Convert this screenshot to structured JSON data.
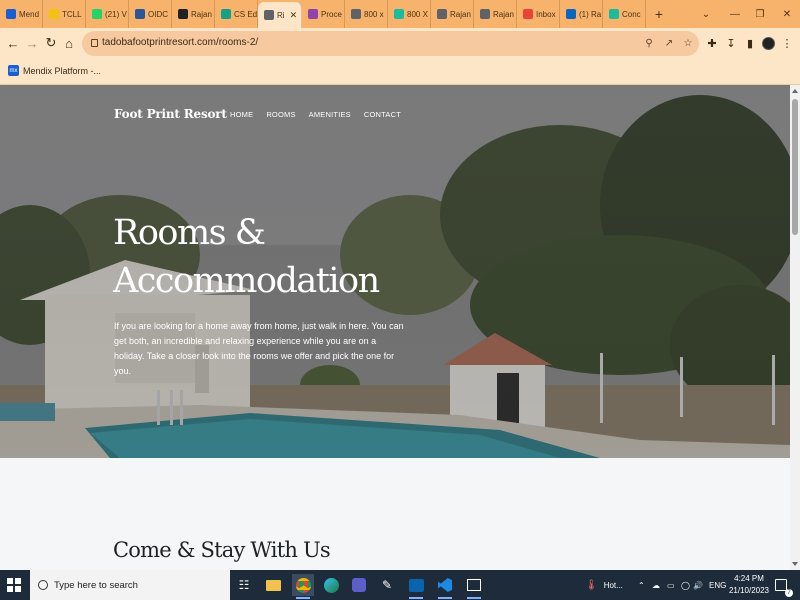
{
  "browser": {
    "tabs": [
      {
        "label": "Mend",
        "color": "#1a5fd0"
      },
      {
        "label": "TCLL",
        "color": "#f1c40f"
      },
      {
        "label": "(21) V",
        "color": "#25d366"
      },
      {
        "label": "OIDC",
        "color": "#2b5797"
      },
      {
        "label": "Rajan",
        "color": "#222222"
      },
      {
        "label": "CS Ed",
        "color": "#16a085"
      },
      {
        "label": "Ri",
        "color": "#5f6368",
        "active": true
      },
      {
        "label": "Proce",
        "color": "#8e44ad"
      },
      {
        "label": "800 x",
        "color": "#5f6368"
      },
      {
        "label": "800 X",
        "color": "#1abc9c"
      },
      {
        "label": "Rajan",
        "color": "#5f6368"
      },
      {
        "label": "Rajan",
        "color": "#5f6368"
      },
      {
        "label": "Inbox",
        "color": "#ea4335"
      },
      {
        "label": "(1) Ra",
        "color": "#0a66c2"
      },
      {
        "label": "Conc",
        "color": "#1abc9c"
      }
    ],
    "new_tab_glyph": "+",
    "window_controls": {
      "dropdown": "⌄",
      "minimize": "—",
      "restore": "❐",
      "close": "✕"
    },
    "url": "tadobafootprintresort.com/rooms-2/",
    "bookmark": {
      "label": "Mendix Platform -...",
      "icon_text": "mx"
    }
  },
  "site": {
    "brand": "Foot Print Resort",
    "nav": [
      "HOME",
      "ROOMS",
      "AMENITIES",
      "CONTACT"
    ],
    "hero_title_line1": "Rooms &",
    "hero_title_line2": "Accommodation",
    "hero_description": "If you are looking for a home away from home, just walk in here. You can get both, an incredible and relaxing experience while you are on a holiday. Take a closer look into the rooms we offer and pick the one for you.",
    "section_title": "Come & Stay With Us"
  },
  "taskbar": {
    "search_placeholder": "Type here to search",
    "weather_label": "Hot...",
    "language": "ENG",
    "time": "4:24 PM",
    "date": "21/10/2023",
    "notification_count": "7"
  },
  "colors": {
    "tabstrip": "#f7b26b",
    "toolbar": "#fde6c8",
    "taskbar": "#1e2b3a"
  }
}
